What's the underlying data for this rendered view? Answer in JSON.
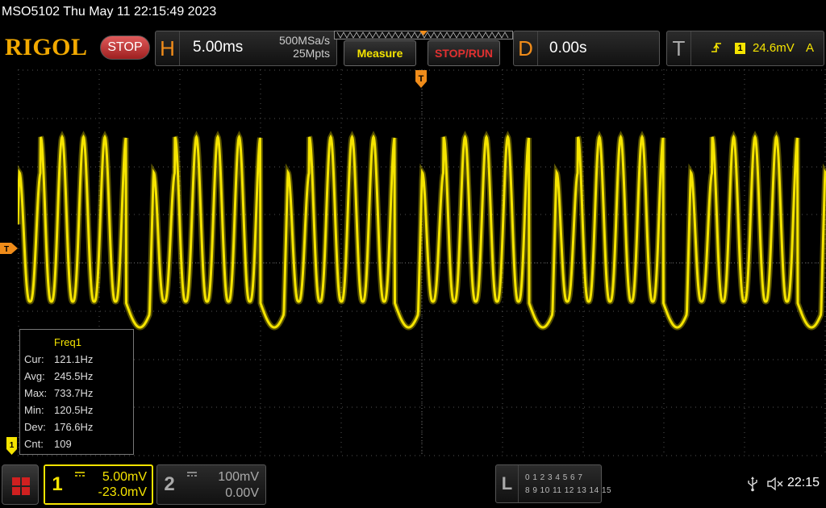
{
  "title_line": "MSO5102  Thu May 11 22:15:49 2023",
  "brand": "RIGOL",
  "run_state": "STOP",
  "horizontal": {
    "letter": "H",
    "timebase": "5.00ms",
    "sample_rate": "500MSa/s",
    "memory_depth": "25Mpts"
  },
  "buttons": {
    "measure": "Measure",
    "stop_run": "STOP/RUN"
  },
  "delay": {
    "letter": "D",
    "value": "0.00s"
  },
  "trigger": {
    "letter": "T",
    "source": "1",
    "level": "24.6mV",
    "mode": "A",
    "marker": "T"
  },
  "measurement": {
    "title": "Freq1",
    "rows": [
      {
        "label": "Cur:",
        "value": "121.1Hz"
      },
      {
        "label": "Avg:",
        "value": "245.5Hz"
      },
      {
        "label": "Max:",
        "value": "733.7Hz"
      },
      {
        "label": "Min:",
        "value": "120.5Hz"
      },
      {
        "label": "Dev:",
        "value": "176.6Hz"
      },
      {
        "label": "Cnt:",
        "value": "109"
      }
    ]
  },
  "channel1": {
    "number": "1",
    "scale": "5.00mV",
    "offset": "-23.0mV",
    "color": "#f5e400"
  },
  "channel2": {
    "number": "2",
    "scale": "100mV",
    "offset": "0.00V"
  },
  "logic": {
    "letter": "L",
    "row1": "0 1 2 3   4 5 6 7",
    "row2": "8 9 10 11 12 13 14 15"
  },
  "clock": "22:15",
  "colors": {
    "accent": "#f08c1a",
    "trace": "#f5e400",
    "stop": "#e03030"
  },
  "icons": [
    "menu-icon",
    "usb-icon",
    "speaker-muted-icon",
    "trigger-rising-edge-icon"
  ]
}
